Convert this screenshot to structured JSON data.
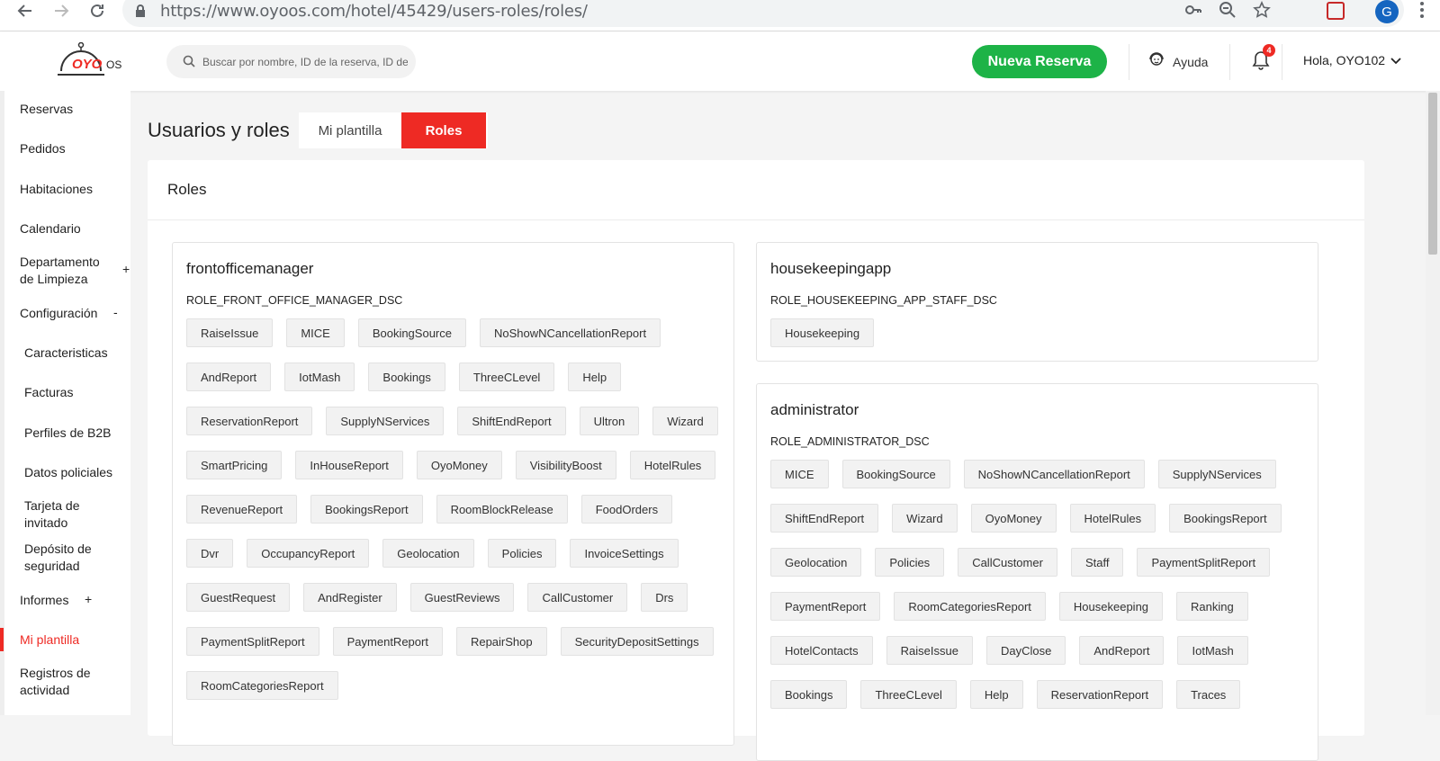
{
  "browser": {
    "url": "https://www.oyoos.com/hotel/45429/users-roles/roles/",
    "profile_initial": "G"
  },
  "header": {
    "logo_text": "OYO",
    "logo_suffix": "OS",
    "search_placeholder": "Buscar por nombre, ID de la reserva, ID de",
    "new_booking_label": "Nueva Reserva",
    "help_label": "Ayuda",
    "notification_count": "4",
    "greeting": "Hola, OYO102"
  },
  "sidebar": {
    "items": [
      {
        "label": "Reservas"
      },
      {
        "label": "Pedidos"
      },
      {
        "label": "Habitaciones"
      },
      {
        "label": "Calendario"
      },
      {
        "label": "Departamento de Limpieza",
        "sign": "+"
      },
      {
        "label": "Configuración",
        "sign": "-"
      },
      {
        "label": "Caracteristicas"
      },
      {
        "label": "Facturas"
      },
      {
        "label": "Perfiles de B2B"
      },
      {
        "label": "Datos policiales"
      },
      {
        "label": "Tarjeta de invitado"
      },
      {
        "label": "Depósito de seguridad"
      },
      {
        "label": "Informes",
        "sign": "+"
      },
      {
        "label": "Mi plantilla"
      },
      {
        "label": "Registros de actividad"
      }
    ]
  },
  "page": {
    "title": "Usuarios y roles",
    "tabs": [
      {
        "label": "Mi plantilla",
        "active": false
      },
      {
        "label": "Roles",
        "active": true
      }
    ],
    "panel_title": "Roles"
  },
  "roles": [
    {
      "name": "frontofficemanager",
      "desc": "ROLE_FRONT_OFFICE_MANAGER_DSC",
      "permissions": [
        "RaiseIssue",
        "MICE",
        "BookingSource",
        "NoShowNCancellationReport",
        "AndReport",
        "IotMash",
        "Bookings",
        "ThreeCLevel",
        "Help",
        "ReservationReport",
        "SupplyNServices",
        "ShiftEndReport",
        "Ultron",
        "Wizard",
        "SmartPricing",
        "InHouseReport",
        "OyoMoney",
        "VisibilityBoost",
        "HotelRules",
        "RevenueReport",
        "BookingsReport",
        "RoomBlockRelease",
        "FoodOrders",
        "Dvr",
        "OccupancyReport",
        "Geolocation",
        "Policies",
        "InvoiceSettings",
        "GuestRequest",
        "AndRegister",
        "GuestReviews",
        "CallCustomer",
        "Drs",
        "PaymentSplitReport",
        "PaymentReport",
        "RepairShop",
        "SecurityDepositSettings",
        "RoomCategoriesReport"
      ]
    },
    {
      "name": "housekeepingapp",
      "desc": "ROLE_HOUSEKEEPING_APP_STAFF_DSC",
      "permissions": [
        "Housekeeping"
      ]
    },
    {
      "name": "administrator",
      "desc": "ROLE_ADMINISTRATOR_DSC",
      "permissions": [
        "MICE",
        "BookingSource",
        "NoShowNCancellationReport",
        "SupplyNServices",
        "ShiftEndReport",
        "Wizard",
        "OyoMoney",
        "HotelRules",
        "BookingsReport",
        "Geolocation",
        "Policies",
        "CallCustomer",
        "Staff",
        "PaymentSplitReport",
        "PaymentReport",
        "RoomCategoriesReport",
        "Housekeeping",
        "Ranking",
        "HotelContacts",
        "RaiseIssue",
        "DayClose",
        "AndReport",
        "IotMash",
        "Bookings",
        "ThreeCLevel",
        "Help",
        "ReservationReport",
        "Traces"
      ]
    }
  ],
  "colors": {
    "accent": "#ee2a24",
    "primary_button": "#1db347"
  }
}
